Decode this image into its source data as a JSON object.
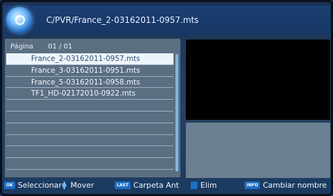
{
  "header": {
    "path": "C/PVR/France_2-03162011-0957.mts"
  },
  "list": {
    "page_label": "Página",
    "page_value": "01 / 01",
    "files": [
      "France_2-03162011-0957.mts",
      "France_3-03162011-0951.mts",
      "France_5-03162011-0958.mts",
      "TF1_HD-02172010-0922.mts",
      "",
      "",
      "",
      "",
      "",
      ""
    ],
    "selected_index": 0
  },
  "footer": {
    "hints": [
      {
        "key": "OK",
        "label": "Seleccionar"
      },
      {
        "key": "arrows",
        "label": "Mover"
      },
      {
        "key": "LAST",
        "label": "Carpeta Ant"
      },
      {
        "key": "RED",
        "label": "Elim"
      },
      {
        "key": "INFO",
        "label": "Cambiar nombre"
      }
    ]
  },
  "colors": {
    "accent": "#1c6fc6",
    "selected_row": "#eef4fb",
    "panel": "#5b6f83"
  }
}
